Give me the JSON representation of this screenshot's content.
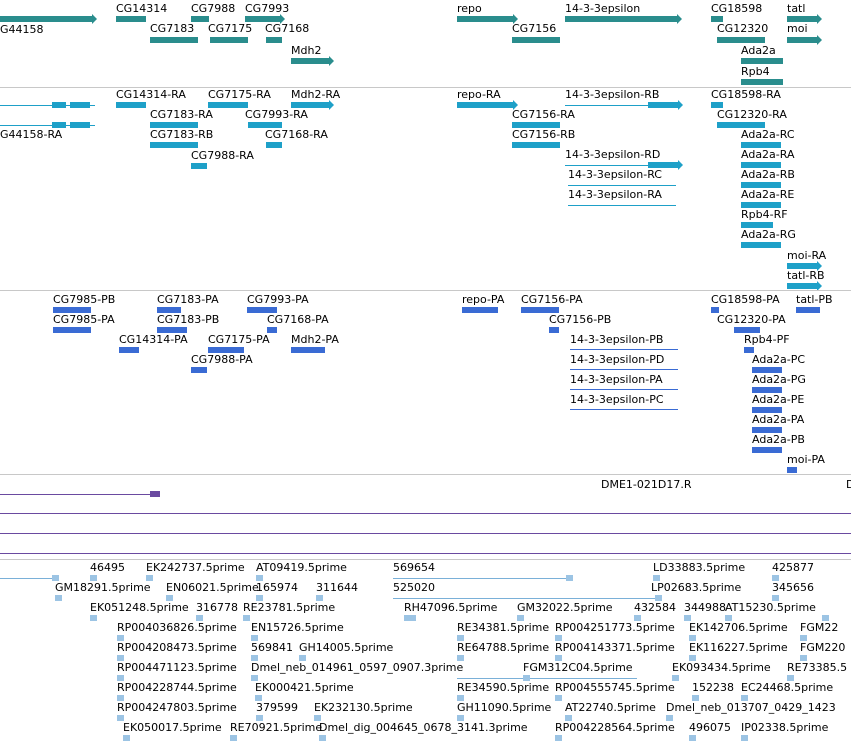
{
  "genes": [
    "G44158",
    "CG14314",
    "CG7988",
    "CG7993",
    "repo",
    "14-3-3epsilon",
    "CG18598",
    "tatl",
    "CG7183",
    "CG7175",
    "CG7168",
    "CG7156",
    "CG12320",
    "moi",
    "Mdh2",
    "Ada2a",
    "Rpb4"
  ],
  "transcripts": [
    "CG14314-RA",
    "CG7175-RA",
    "Mdh2-RA",
    "repo-RA",
    "14-3-3epsilon-RB",
    "CG18598-RA",
    "CG7183-RA",
    "CG7993-RA",
    "CG7156-RA",
    "CG12320-RA",
    "G44158-RA",
    "CG7183-RB",
    "CG7168-RA",
    "CG7156-RB",
    "Ada2a-RC",
    "CG7988-RA",
    "14-3-3epsilon-RD",
    "Ada2a-RA",
    "14-3-3epsilon-RC",
    "Ada2a-RB",
    "14-3-3epsilon-RA",
    "Ada2a-RE",
    "Rpb4-RF",
    "Ada2a-RG",
    "moi-RA",
    "tatl-RB"
  ],
  "proteins": [
    "CG7985-PB",
    "CG7183-PA",
    "CG7993-PA",
    "repo-PA",
    "CG7156-PA",
    "CG18598-PA",
    "tatl-PB",
    "CG7985-PA",
    "CG7183-PB",
    "CG7168-PA",
    "CG7156-PB",
    "CG12320-PA",
    "CG14314-PA",
    "CG7175-PA",
    "Mdh2-PA",
    "14-3-3epsilon-PB",
    "Rpb4-PF",
    "CG7988-PA",
    "14-3-3epsilon-PD",
    "Ada2a-PC",
    "14-3-3epsilon-PA",
    "Ada2a-PG",
    "14-3-3epsilon-PC",
    "Ada2a-PE",
    "Ada2a-PA",
    "Ada2a-PB",
    "moi-PA"
  ],
  "clones": [
    "DME1-021D17.R",
    "D"
  ],
  "ests": [
    "46495",
    "EK242737.5prime",
    "AT09419.5prime",
    "569654",
    "LD33883.5prime",
    "425877",
    "GM18291.5prime",
    "EN06021.5prime",
    "165974",
    "311644",
    "525020",
    "LP02683.5prime",
    "345656",
    "EK051248.5prime",
    "316778",
    "RE23781.5prime",
    "RH47096.5prime",
    "GM32022.5prime",
    "432584",
    "344988",
    "AT15230.5prime",
    "RP004036826.5prime",
    "EN15726.5prime",
    "RE34381.5prime",
    "RP004251773.5prime",
    "EK142706.5prime",
    "FGM22",
    "RP004208473.5prime",
    "569841",
    "GH14005.5prime",
    "RE64788.5prime",
    "RP004143371.5prime",
    "EK116227.5prime",
    "FGM220",
    "RP004471123.5prime",
    "Dmel_neb_014961_0597_0907.3prime",
    "FGM312C04.5prime",
    "EK093434.5prime",
    "RE73385.5",
    "RP004228744.5prime",
    "EK000421.5prime",
    "RE34590.5prime",
    "RP004555745.5prime",
    "152238",
    "EC24468.5prime",
    "RP004247803.5prime",
    "379599",
    "EK232130.5prime",
    "GH11090.5prime",
    "AT22740.5prime",
    "Dmel_neb_013707_0429_1423",
    "EK050017.5prime",
    "RE70921.5prime",
    "Dmel_dig_004645_0678_3141.3prime",
    "RP004228564.5prime",
    "496075",
    "IP02338.5prime"
  ]
}
